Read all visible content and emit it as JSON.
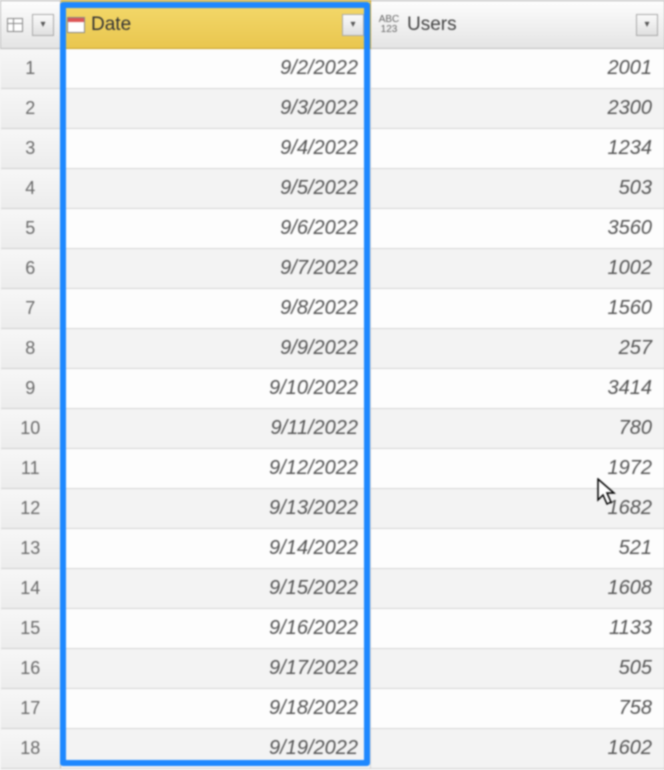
{
  "columns": {
    "date": {
      "label": "Date",
      "type_icon": "calendar-icon",
      "filter_glyph": "▾"
    },
    "users": {
      "label": "Users",
      "type_icon_top": "ABC",
      "type_icon_bottom": "123",
      "filter_glyph": "▾"
    }
  },
  "rownum_header": {
    "filter_glyph": "▾"
  },
  "rows": [
    {
      "n": "1",
      "date": "9/2/2022",
      "users": "2001"
    },
    {
      "n": "2",
      "date": "9/3/2022",
      "users": "2300"
    },
    {
      "n": "3",
      "date": "9/4/2022",
      "users": "1234"
    },
    {
      "n": "4",
      "date": "9/5/2022",
      "users": "503"
    },
    {
      "n": "5",
      "date": "9/6/2022",
      "users": "3560"
    },
    {
      "n": "6",
      "date": "9/7/2022",
      "users": "1002"
    },
    {
      "n": "7",
      "date": "9/8/2022",
      "users": "1560"
    },
    {
      "n": "8",
      "date": "9/9/2022",
      "users": "257"
    },
    {
      "n": "9",
      "date": "9/10/2022",
      "users": "3414"
    },
    {
      "n": "10",
      "date": "9/11/2022",
      "users": "780"
    },
    {
      "n": "11",
      "date": "9/12/2022",
      "users": "1972"
    },
    {
      "n": "12",
      "date": "9/13/2022",
      "users": "1682"
    },
    {
      "n": "13",
      "date": "9/14/2022",
      "users": "521"
    },
    {
      "n": "14",
      "date": "9/15/2022",
      "users": "1608"
    },
    {
      "n": "15",
      "date": "9/16/2022",
      "users": "1133"
    },
    {
      "n": "16",
      "date": "9/17/2022",
      "users": "505"
    },
    {
      "n": "17",
      "date": "9/18/2022",
      "users": "758"
    },
    {
      "n": "18",
      "date": "9/19/2022",
      "users": "1602"
    }
  ]
}
